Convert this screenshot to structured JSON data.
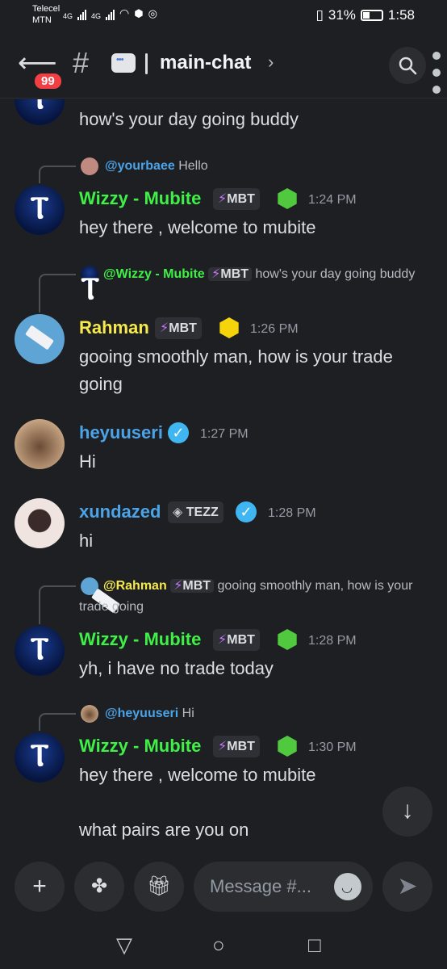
{
  "status_bar": {
    "carrier1": "Telecel",
    "carrier2": "MTN",
    "network1": "4G",
    "network2": "4G",
    "battery_percent": "31%",
    "time": "1:58"
  },
  "header": {
    "unread_badge": "99",
    "channel_name": "main-chat",
    "back_icon": "back-arrow-icon",
    "hash_icon": "hash-icon",
    "search_icon": "search-icon"
  },
  "messages": [
    {
      "partial": true,
      "body": "how's your day going buddy"
    },
    {
      "reply": {
        "name": "@yourbaee",
        "text": "Hello"
      },
      "username": "Wizzy - Mubite",
      "tag": "MBT",
      "time": "1:24 PM",
      "body": "hey there , welcome to mubite"
    },
    {
      "reply": {
        "name": "@Wizzy - Mubite",
        "tag": "MBT",
        "text": "how's your day going buddy"
      },
      "username": "Rahman",
      "tag": "MBT",
      "time": "1:26 PM",
      "body": "gooing smoothly man,  how is your trade going"
    },
    {
      "username": "heyuuseri",
      "time": "1:27 PM",
      "body": "Hi"
    },
    {
      "username": "xundazed",
      "tag": "TEZZ",
      "time": "1:28 PM",
      "body": "hi"
    },
    {
      "reply": {
        "name": "@Rahman",
        "tag": "MBT",
        "text": "gooing smoothly man,  how is your trade going"
      },
      "username": "Wizzy - Mubite",
      "tag": "MBT",
      "time": "1:28 PM",
      "body": "yh, i have no trade today"
    },
    {
      "reply": {
        "name": "@heyuuseri",
        "text": "Hi"
      },
      "username": "Wizzy - Mubite",
      "tag": "MBT",
      "time": "1:30 PM",
      "body": "hey there , welcome to mubite",
      "body2": "what pairs are you on"
    }
  ],
  "composer": {
    "placeholder": "Message #..."
  },
  "colors": {
    "background": "#1e1f22",
    "wizzy_name": "#3ff047",
    "rahman_name": "#f5e94c",
    "blue_name": "#4ba3e8",
    "badge_red": "#f23f43"
  }
}
